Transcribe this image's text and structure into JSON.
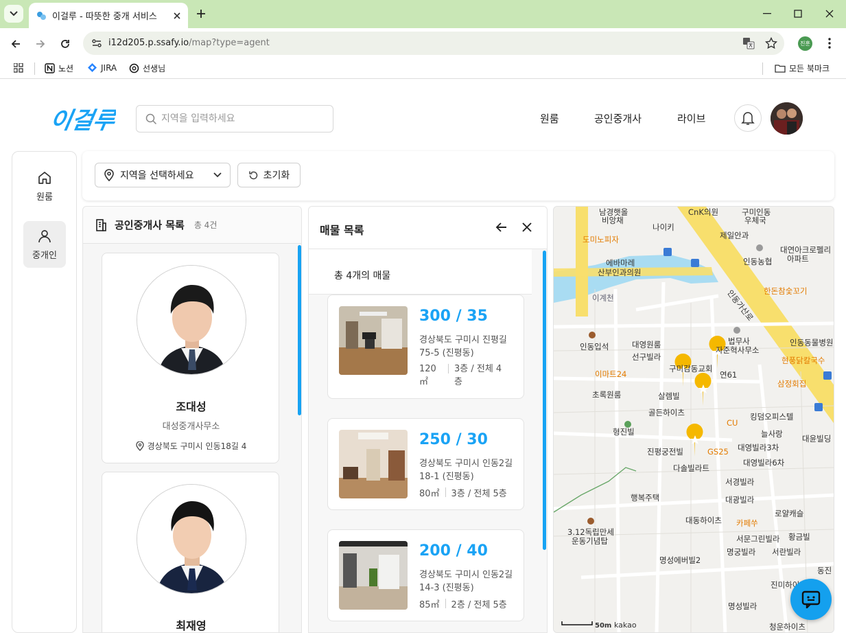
{
  "browser": {
    "tab_title": "이걸루 - 따뜻한 중개 서비스",
    "url_host": "i12d205.p.ssafy.io",
    "url_path": "/map?type=agent",
    "profile_label": "진훈",
    "bookmarks": [
      "노션",
      "JIRA",
      "선생님"
    ],
    "all_bookmarks": "모든 북마크"
  },
  "header": {
    "logo_text": "이걸루",
    "search_placeholder": "지역을 입력하세요",
    "nav": [
      "원룸",
      "공인중개사",
      "라이브"
    ]
  },
  "sidebar": {
    "items": [
      {
        "label": "원룸",
        "icon": "home-icon"
      },
      {
        "label": "중개인",
        "icon": "user-icon"
      }
    ]
  },
  "filters": {
    "region_placeholder": "지역을 선택하세요",
    "reset_label": "초기화"
  },
  "agents": {
    "title": "공인중개사 목록",
    "count": "총 4건",
    "list": [
      {
        "name": "조대성",
        "office": "대성중개사무소",
        "address": "경상북도 구미시 인동18길 4"
      },
      {
        "name": "최재영",
        "office": "",
        "address": ""
      }
    ]
  },
  "listings": {
    "title": "매물 목록",
    "count": "총 4개의 매물",
    "items": [
      {
        "price": "300 / 35",
        "address": "경상북도 구미시 진평길 75-5 (진평동)",
        "area": "120 ㎡",
        "floor": "3층 / 전체 4층"
      },
      {
        "price": "250 / 30",
        "address": "경상북도 구미시 인동2길 18-1 (진평동)",
        "area": "80㎡",
        "floor": "3층 / 전체 5층"
      },
      {
        "price": "200 / 40",
        "address": "경상북도 구미시 인동2길 14-3 (진평동)",
        "area": "85㎡",
        "floor": "2층 / 전체 5층"
      }
    ]
  },
  "map": {
    "labels": [
      "남경햇올",
      "비앙채",
      "CnK의원",
      "구미인동",
      "우체국",
      "나이키",
      "제일안과",
      "도미노피자",
      "에바마레",
      "산부인과의원",
      "인동농협",
      "대연아크로펠리",
      "아파트",
      "한돈참숯꼬기",
      "이계천",
      "인동가산로",
      "인동입석",
      "대영원룸",
      "선구빌라",
      "법무사",
      "자준혁사무소",
      "인동동물병원",
      "현풍닭칼국수",
      "이마트24",
      "구미감동교회",
      "연61",
      "삼정회집",
      "초록원룸",
      "살렘빌",
      "골든하이츠",
      "CU",
      "킹덤오피스텔",
      "형진빌",
      "GS25",
      "늘사랑",
      "대윤빌딩",
      "진평궁전빌",
      "대영빌라3차",
      "대영빌라6차",
      "다솔빌라트",
      "서경빌라",
      "행복주택",
      "대광빌라",
      "로얄캐슬",
      "대동하이츠",
      "카페쑤",
      "서문그린빌라",
      "황금빌",
      "3.12독립만세",
      "운동기념탑",
      "명궁빌라",
      "서란빌라",
      "명성에버빌2",
      "동진",
      "진미하이츠",
      "명성빌라",
      "청운하이츠",
      "50m",
      "kakao"
    ]
  },
  "colors": {
    "accent": "#1aa3f5",
    "tab_strip": "#c9e7b6",
    "map_yellow": "#f8df6d",
    "marker": "#f5b800"
  }
}
